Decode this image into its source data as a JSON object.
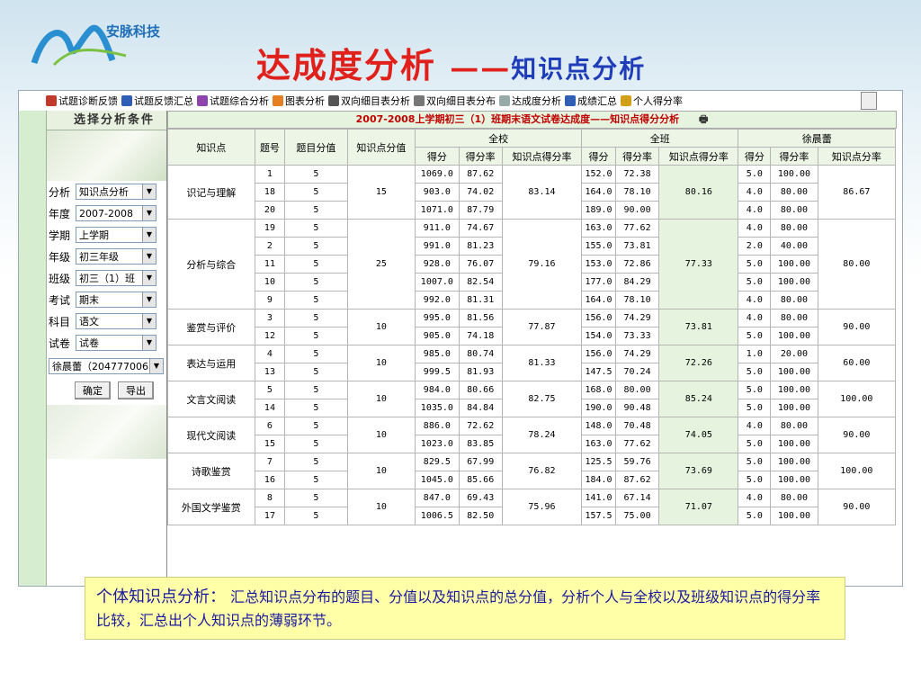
{
  "logo": {
    "text": "安脉科技"
  },
  "title": {
    "main": "达成度分析",
    "dash": "——",
    "sub": "知识点分析"
  },
  "toolbar": [
    {
      "label": "试题诊断反馈",
      "icon": "diagnosis-icon",
      "color": "#c0392b"
    },
    {
      "label": "试题反馈汇总",
      "icon": "summary-icon",
      "color": "#2e5fb5"
    },
    {
      "label": "试题综合分析",
      "icon": "analysis-icon",
      "color": "#8e44ad"
    },
    {
      "label": "图表分析",
      "icon": "chart-icon",
      "color": "#e67e22"
    },
    {
      "label": "双向细目表分析",
      "icon": "pencil-icon",
      "color": "#555"
    },
    {
      "label": "双向细目表分布",
      "icon": "binocular-icon",
      "color": "#777"
    },
    {
      "label": "达成度分析",
      "icon": "reach-icon",
      "color": "#9aa"
    },
    {
      "label": "成绩汇总",
      "icon": "bar-chart-icon",
      "color": "#2e5fb5"
    },
    {
      "label": "个人得分率",
      "icon": "person-icon",
      "color": "#d4a017"
    }
  ],
  "sidebar": {
    "header": "选择分析条件",
    "fields": [
      {
        "label": "分析",
        "value": "知识点分析"
      },
      {
        "label": "年度",
        "value": "2007-2008"
      },
      {
        "label": "学期",
        "value": "上学期"
      },
      {
        "label": "年级",
        "value": "初三年级"
      },
      {
        "label": "班级",
        "value": "初三（1）班"
      },
      {
        "label": "考试",
        "value": "期末"
      },
      {
        "label": "科目",
        "value": "语文"
      },
      {
        "label": "试卷",
        "value": "试卷"
      }
    ],
    "student": "徐晨蕾（204777006",
    "confirm": "确定",
    "export": "导出"
  },
  "table": {
    "caption": "2007-2008上学期初三（1）班期末语文试卷达成度——知识点得分分析",
    "headers": {
      "knowledge": "知识点",
      "qno": "题号",
      "qscore": "题目分值",
      "kscore": "知识点分值",
      "school": "全校",
      "grade": "全班",
      "student": "徐晨蕾",
      "score": "得分",
      "rate": "得分率",
      "krate": "知识点得分率",
      "kpct": "知识点分率"
    },
    "groups": [
      {
        "name": "识记与理解",
        "kscore": "15",
        "school_k": "83.14",
        "class_k": "80.16",
        "stu_k": "86.67",
        "rows": [
          [
            "1",
            "5",
            "1069.0",
            "87.62",
            "152.0",
            "72.38",
            "5.0",
            "100.00"
          ],
          [
            "18",
            "5",
            "903.0",
            "74.02",
            "164.0",
            "78.10",
            "4.0",
            "80.00"
          ],
          [
            "20",
            "5",
            "1071.0",
            "87.79",
            "189.0",
            "90.00",
            "4.0",
            "80.00"
          ]
        ]
      },
      {
        "name": "分析与综合",
        "kscore": "25",
        "school_k": "79.16",
        "class_k": "77.33",
        "stu_k": "80.00",
        "rows": [
          [
            "19",
            "5",
            "911.0",
            "74.67",
            "163.0",
            "77.62",
            "4.0",
            "80.00"
          ],
          [
            "2",
            "5",
            "991.0",
            "81.23",
            "155.0",
            "73.81",
            "2.0",
            "40.00"
          ],
          [
            "11",
            "5",
            "928.0",
            "76.07",
            "153.0",
            "72.86",
            "5.0",
            "100.00"
          ],
          [
            "10",
            "5",
            "1007.0",
            "82.54",
            "177.0",
            "84.29",
            "5.0",
            "100.00"
          ],
          [
            "9",
            "5",
            "992.0",
            "81.31",
            "164.0",
            "78.10",
            "4.0",
            "80.00"
          ]
        ]
      },
      {
        "name": "鉴赏与评价",
        "kscore": "10",
        "school_k": "77.87",
        "class_k": "73.81",
        "stu_k": "90.00",
        "rows": [
          [
            "3",
            "5",
            "995.0",
            "81.56",
            "156.0",
            "74.29",
            "4.0",
            "80.00"
          ],
          [
            "12",
            "5",
            "905.0",
            "74.18",
            "154.0",
            "73.33",
            "5.0",
            "100.00"
          ]
        ]
      },
      {
        "name": "表达与运用",
        "kscore": "10",
        "school_k": "81.33",
        "class_k": "72.26",
        "stu_k": "60.00",
        "rows": [
          [
            "4",
            "5",
            "985.0",
            "80.74",
            "156.0",
            "74.29",
            "1.0",
            "20.00"
          ],
          [
            "13",
            "5",
            "999.5",
            "81.93",
            "147.5",
            "70.24",
            "5.0",
            "100.00"
          ]
        ]
      },
      {
        "name": "文言文阅读",
        "kscore": "10",
        "school_k": "82.75",
        "class_k": "85.24",
        "stu_k": "100.00",
        "rows": [
          [
            "5",
            "5",
            "984.0",
            "80.66",
            "168.0",
            "80.00",
            "5.0",
            "100.00"
          ],
          [
            "14",
            "5",
            "1035.0",
            "84.84",
            "190.0",
            "90.48",
            "5.0",
            "100.00"
          ]
        ]
      },
      {
        "name": "现代文阅读",
        "kscore": "10",
        "school_k": "78.24",
        "class_k": "74.05",
        "stu_k": "90.00",
        "rows": [
          [
            "6",
            "5",
            "886.0",
            "72.62",
            "148.0",
            "70.48",
            "4.0",
            "80.00"
          ],
          [
            "15",
            "5",
            "1023.0",
            "83.85",
            "163.0",
            "77.62",
            "5.0",
            "100.00"
          ]
        ]
      },
      {
        "name": "诗歌鉴赏",
        "kscore": "10",
        "school_k": "76.82",
        "class_k": "73.69",
        "stu_k": "100.00",
        "rows": [
          [
            "7",
            "5",
            "829.5",
            "67.99",
            "125.5",
            "59.76",
            "5.0",
            "100.00"
          ],
          [
            "16",
            "5",
            "1045.0",
            "85.66",
            "184.0",
            "87.62",
            "5.0",
            "100.00"
          ]
        ]
      },
      {
        "name": "外国文学鉴赏",
        "kscore": "10",
        "school_k": "75.96",
        "class_k": "71.07",
        "stu_k": "90.00",
        "rows": [
          [
            "8",
            "5",
            "847.0",
            "69.43",
            "141.0",
            "67.14",
            "4.0",
            "80.00"
          ],
          [
            "17",
            "5",
            "1006.5",
            "82.50",
            "157.5",
            "75.00",
            "5.0",
            "100.00"
          ]
        ]
      }
    ]
  },
  "description": {
    "head": "个体知识点分析：",
    "body": "汇总知识点分布的题目、分值以及知识点的总分值，分析个人与全校以及班级知识点的得分率比较，汇总出个人知识点的薄弱环节。"
  }
}
